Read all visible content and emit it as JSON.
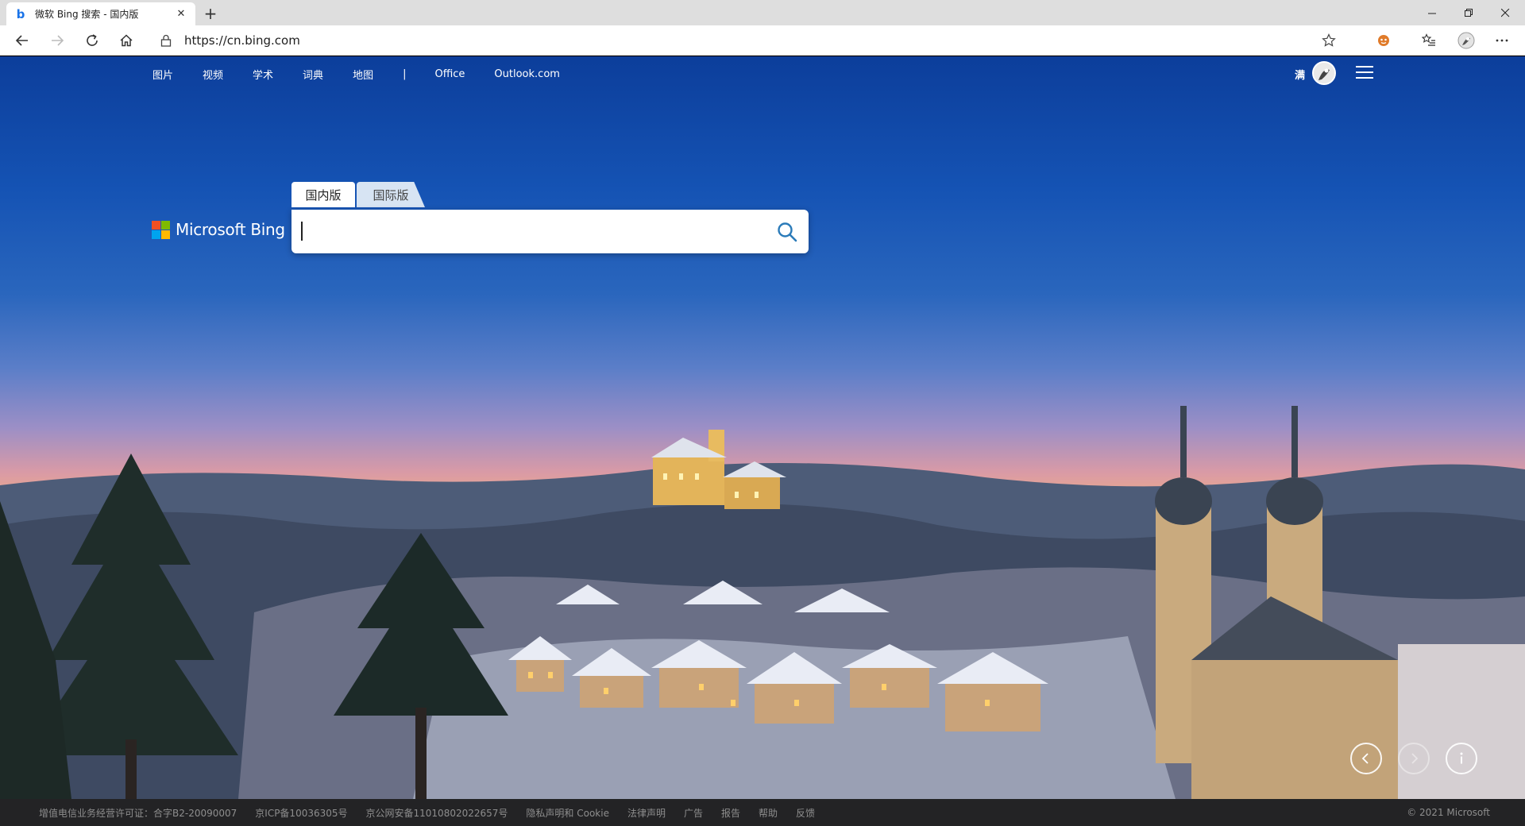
{
  "browser": {
    "tab_title": "微软 Bing 搜索 - 国内版",
    "favicon_letter": "b",
    "close_glyph": "✕",
    "newtab_glyph": "+",
    "url": "https://cn.bing.com"
  },
  "nav": {
    "links": [
      "图片",
      "视频",
      "学术",
      "词典",
      "地图"
    ],
    "separator": "|",
    "office": "Office",
    "outlook": "Outlook.com"
  },
  "user": {
    "name": "满"
  },
  "logo": {
    "text": "Microsoft Bing"
  },
  "search": {
    "tab_domestic": "国内版",
    "tab_international": "国际版",
    "value": ""
  },
  "footer": {
    "links": [
      "增值电信业务经营许可证：合字B2-20090007",
      "京ICP备10036305号",
      "京公网安备11010802022657号",
      "隐私声明和 Cookie",
      "法律声明",
      "广告",
      "报告",
      "帮助",
      "反馈"
    ],
    "copyright": "© 2021 Microsoft"
  },
  "colors": {
    "accent": "#1a73e8",
    "search_icon": "#2b7bb9",
    "footer_bg": "#262628"
  }
}
